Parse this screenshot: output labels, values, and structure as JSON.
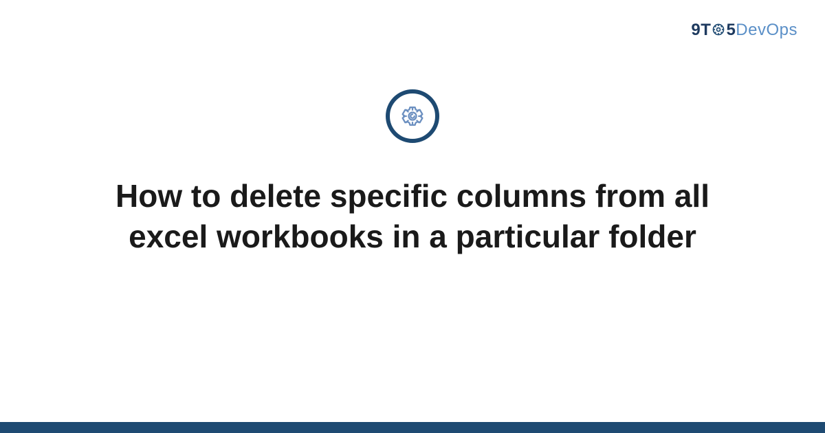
{
  "logo": {
    "part1": "9T",
    "part2": "5",
    "part3": "Dev",
    "part4": "Ops"
  },
  "title": "How to delete specific columns from all excel workbooks in a particular folder",
  "colors": {
    "brand_dark": "#1e4a72",
    "brand_light": "#5a8fc7",
    "text": "#1a1a1a"
  }
}
